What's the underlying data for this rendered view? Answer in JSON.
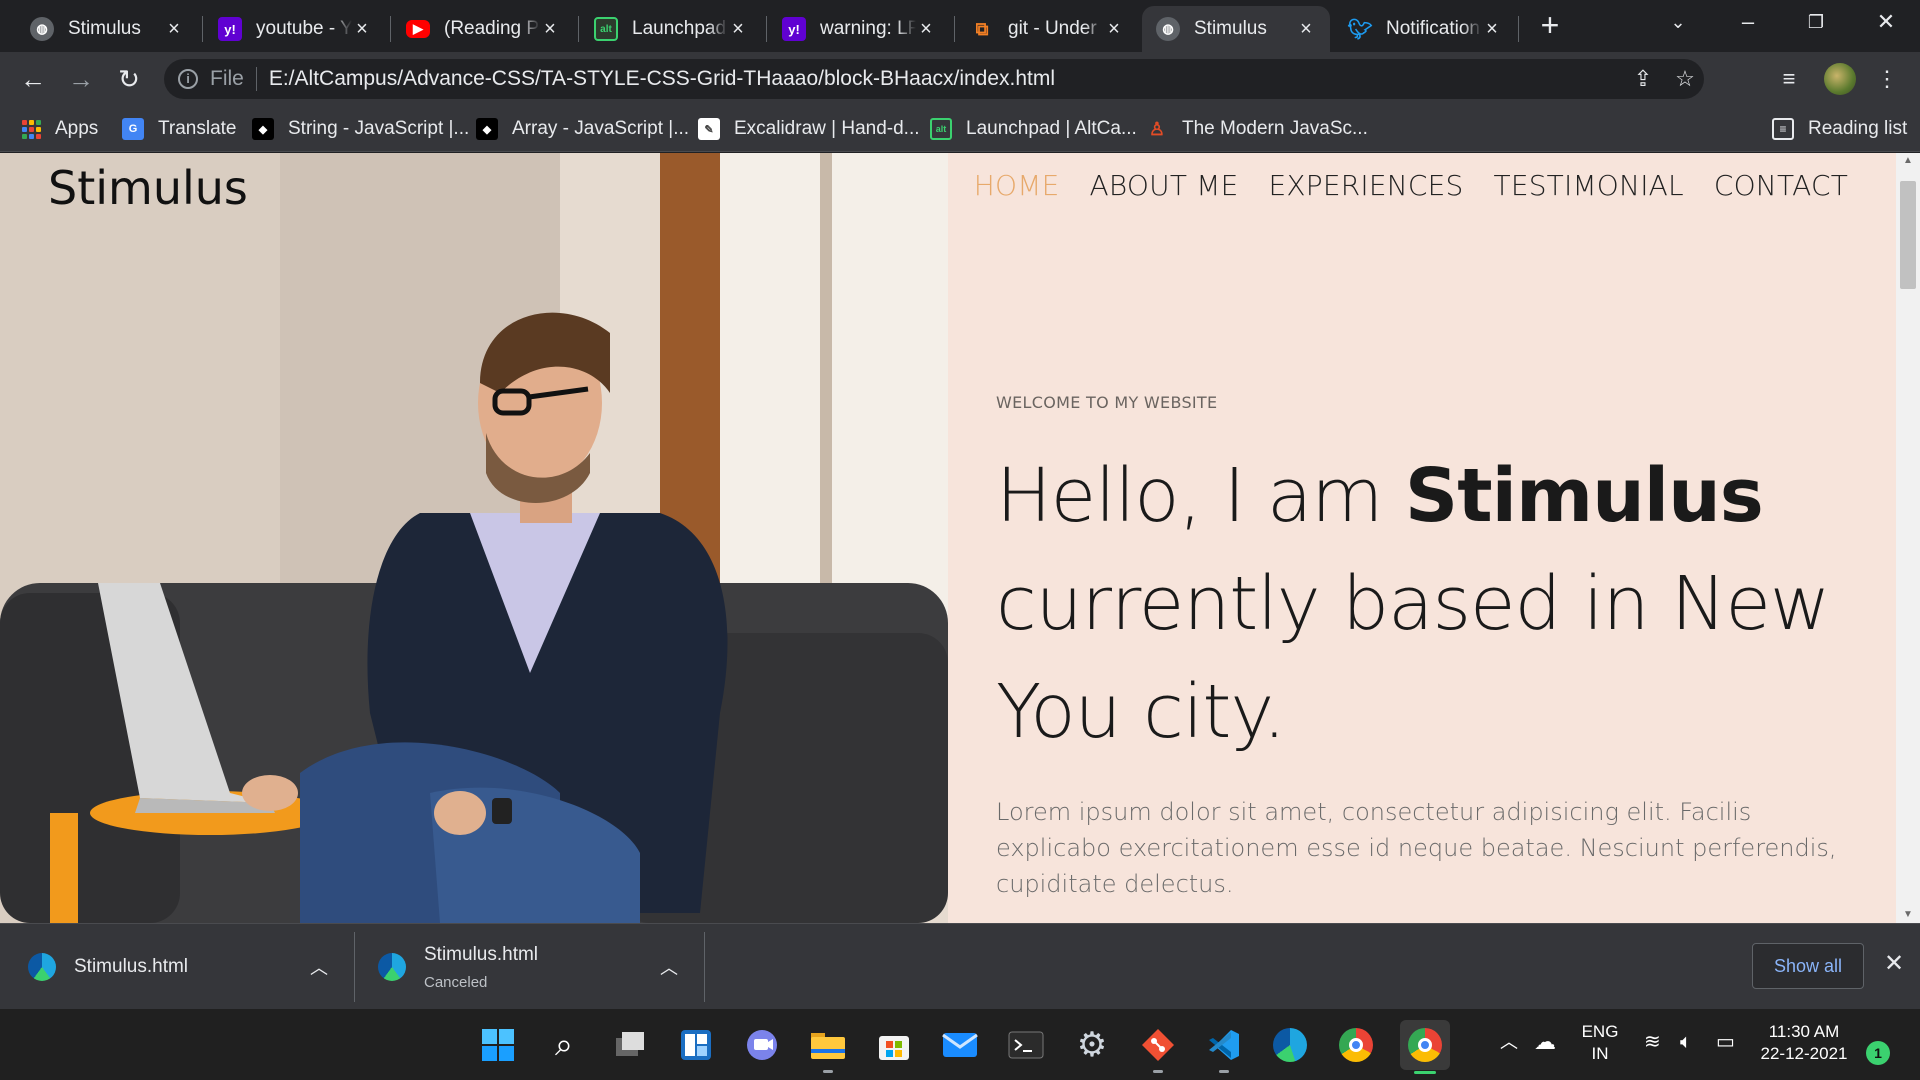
{
  "browser": {
    "tabs": [
      {
        "title": "Stimulus",
        "icon": "globe-icon"
      },
      {
        "title": "youtube - Y",
        "icon": "yahoo-icon"
      },
      {
        "title": "(Reading Pr",
        "icon": "youtube-icon"
      },
      {
        "title": "Launchpad",
        "icon": "altcampus-icon"
      },
      {
        "title": "warning: LF",
        "icon": "yahoo-icon"
      },
      {
        "title": "git - Under",
        "icon": "stackoverflow-icon"
      },
      {
        "title": "Stimulus",
        "icon": "globe-icon",
        "active": true
      },
      {
        "title": "Notification",
        "icon": "twitter-icon"
      }
    ],
    "address": {
      "scheme": "File",
      "url": "E:/AltCampus/Advance-CSS/TA-STYLE-CSS-Grid-THaaao/block-BHaacx/index.html"
    },
    "bookmarks": [
      {
        "label": "Apps",
        "icon": "apps-grid-icon"
      },
      {
        "label": "Translate",
        "icon": "google-translate-icon"
      },
      {
        "label": "String - JavaScript |...",
        "icon": "mdn-icon"
      },
      {
        "label": "Array - JavaScript |...",
        "icon": "mdn-icon"
      },
      {
        "label": "Excalidraw | Hand-d...",
        "icon": "excalidraw-icon"
      },
      {
        "label": "Launchpad | AltCa...",
        "icon": "altcampus-icon"
      },
      {
        "label": "The Modern JavaSc...",
        "icon": "javascript-info-icon"
      }
    ],
    "reading_list": "Reading list"
  },
  "site": {
    "logo": "Stimulus",
    "nav": [
      "HOME",
      "ABOUT ME",
      "EXPERIENCES",
      "TESTIMONIAL",
      "CONTACT"
    ],
    "eyebrow": "WELCOME TO MY WEBSITE",
    "headline_pre": "Hello, I am ",
    "headline_name": "Stimulus",
    "headline_post": " currently based in New You city.",
    "lede": "Lorem ipsum dolor sit amet, consectetur adipisicing elit. Facilis explicabo exercitationem esse id neque beatae. Nesciunt perferendis, cupiditate delectus."
  },
  "downloads": {
    "items": [
      {
        "name": "Stimulus.html",
        "status": ""
      },
      {
        "name": "Stimulus.html",
        "status": "Canceled"
      }
    ],
    "show_all": "Show all"
  },
  "taskbar": {
    "apps": [
      "start-icon",
      "search-icon",
      "task-view-icon",
      "widgets-icon",
      "teams-chat-icon",
      "file-explorer-icon",
      "store-icon",
      "mail-icon",
      "terminal-icon",
      "settings-icon",
      "git-icon",
      "vscode-icon",
      "edge-icon",
      "chrome-icon",
      "chrome-active-icon"
    ],
    "lang_top": "ENG",
    "lang_bottom": "IN",
    "time": "11:30 AM",
    "date": "22-12-2021",
    "notifications": "1"
  },
  "colors": {
    "page_bg": "#f7e4db",
    "nav_active": "#e7a96b",
    "link_blue": "#8ab4f8"
  }
}
